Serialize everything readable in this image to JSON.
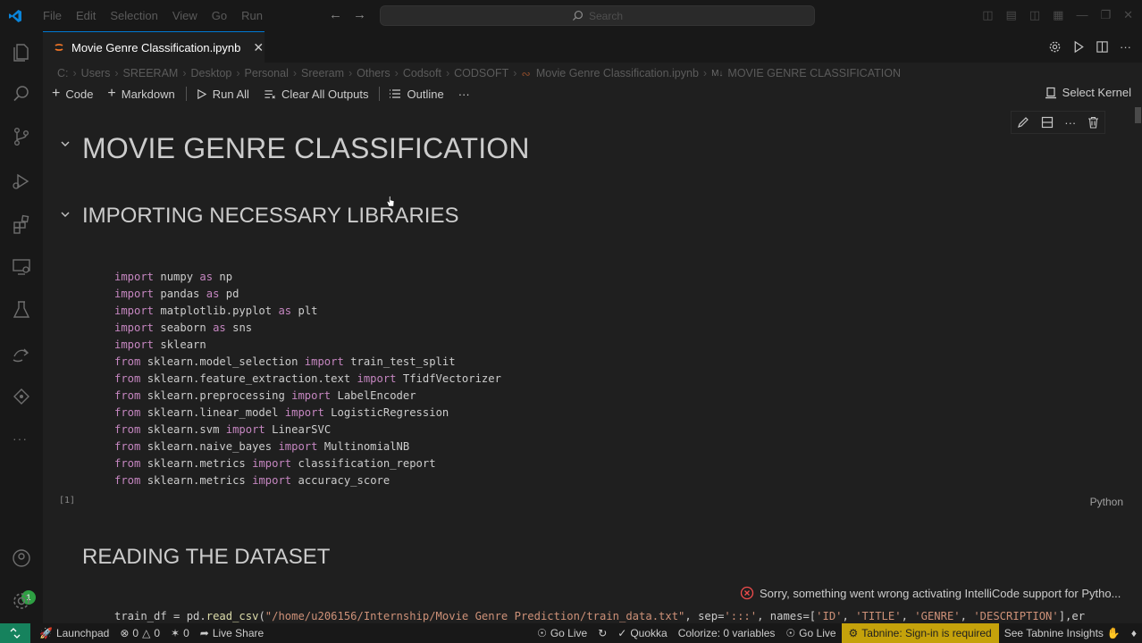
{
  "menu": [
    "File",
    "Edit",
    "Selection",
    "View",
    "Go",
    "Run"
  ],
  "search_placeholder": "Search",
  "tab": {
    "title": "Movie Genre Classification.ipynb"
  },
  "breadcrumb": [
    "C:",
    "Users",
    "SREERAM",
    "Desktop",
    "Personal",
    "Sreeram",
    "Others",
    "Codsoft",
    "CODSOFT",
    "Movie Genre Classification.ipynb",
    "MOVIE GENRE CLASSIFICATION"
  ],
  "toolbar": {
    "code": "Code",
    "markdown": "Markdown",
    "run_all": "Run All",
    "clear_outputs": "Clear All Outputs",
    "outline": "Outline",
    "more": "···",
    "select_kernel": "Select Kernel"
  },
  "cells": {
    "h1": "MOVIE GENRE CLASSIFICATION",
    "h2_imports": "IMPORTING NECESSARY LIBRARIES",
    "exec_count": "[1]",
    "language": "Python",
    "h2_reading": "READING THE DATASET"
  },
  "code_lines": [
    [
      "import",
      " numpy ",
      "as",
      " np"
    ],
    [
      "import",
      " pandas ",
      "as",
      " pd"
    ],
    [
      "import",
      " matplotlib.pyplot ",
      "as",
      " plt"
    ],
    [
      "import",
      " seaborn ",
      "as",
      " sns"
    ],
    [
      "import",
      " sklearn",
      "",
      ""
    ],
    [
      "from",
      " sklearn.model_selection ",
      "import",
      " train_test_split"
    ],
    [
      "from",
      " sklearn.feature_extraction.text ",
      "import",
      " TfidfVectorizer"
    ],
    [
      "from",
      " sklearn.preprocessing ",
      "import",
      " LabelEncoder"
    ],
    [
      "from",
      " sklearn.linear_model ",
      "import",
      " LogisticRegression"
    ],
    [
      "from",
      " sklearn.svm ",
      "import",
      " LinearSVC"
    ],
    [
      "from",
      " sklearn.naive_bayes ",
      "import",
      " MultinomialNB"
    ],
    [
      "from",
      " sklearn.metrics ",
      "import",
      " classification_report"
    ],
    [
      "from",
      " sklearn.metrics ",
      "import",
      " accuracy_score"
    ]
  ],
  "code2": {
    "prefix": "train_df = pd.",
    "fn": "read_csv",
    "open": "(",
    "path": "\"/home/u206156/Internship/Movie Genre Prediction/train_data.txt\"",
    "mid": ", sep=",
    "sep": "':::'",
    "names_kw": ", names=[",
    "n1": "'ID'",
    "n2": "'TITLE'",
    "n3": "'GENRE'",
    "n4": "'DESCRIPTION'",
    "tail": "],er"
  },
  "notification": "Sorry, something went wrong activating IntelliCode support for Pytho...",
  "status": {
    "launchpad": "Launchpad",
    "errors": "0",
    "warnings": "0",
    "ports": "0",
    "live_share": "Live Share",
    "go_live": "Go Live",
    "quokka": "Quokka",
    "colorize": "Colorize: 0 variables",
    "go_live_2": "Go Live",
    "tabnine": "Tabnine: Sign-in is required",
    "insights": "See Tabnine Insights"
  },
  "accounts_badge": "1",
  "colors": {
    "accent": "#0078d4",
    "keyword": "#c586c0",
    "remote": "#16825d",
    "tabnine": "#c5a20b"
  }
}
